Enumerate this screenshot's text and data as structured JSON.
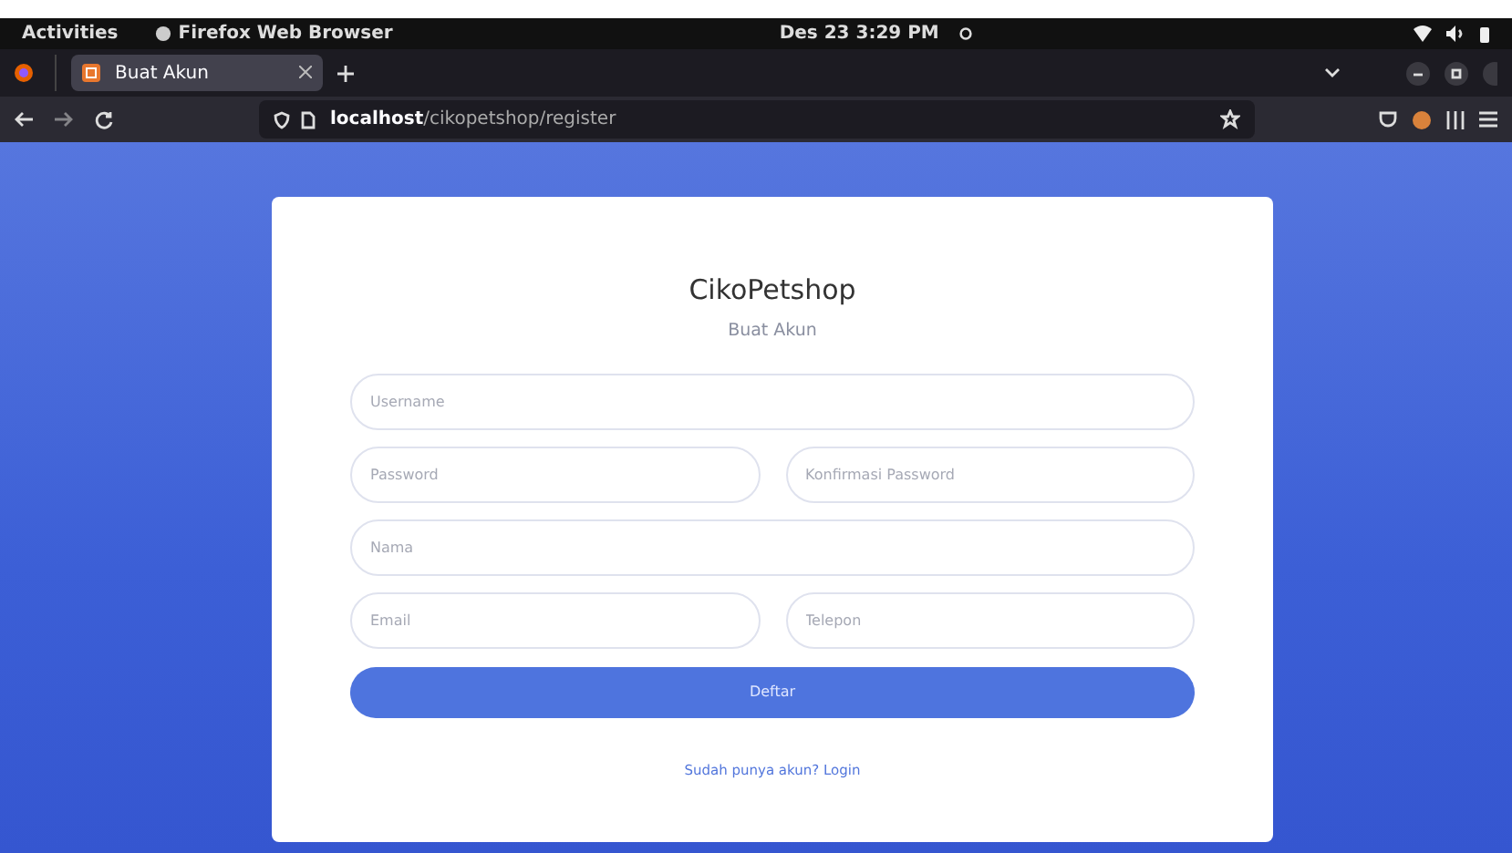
{
  "topbar": {
    "activities": "Activities",
    "app_name": "Firefox Web Browser",
    "clock": "Des 23  3:29 PM"
  },
  "tabs": [
    {
      "label": "Buat Akun",
      "selected": true
    }
  ],
  "address_bar": {
    "host": "localhost",
    "path": "/cikopetshop/register"
  },
  "form": {
    "title": "CikoPetshop",
    "subtitle": "Buat Akun",
    "rows": [
      [
        {
          "placeholder": "Username"
        }
      ],
      [
        {
          "placeholder": "Password"
        },
        {
          "placeholder": "Konfirmasi Password"
        }
      ],
      [
        {
          "placeholder": "Nama"
        }
      ],
      [
        {
          "placeholder": "Email"
        },
        {
          "placeholder": "Telepon"
        }
      ]
    ],
    "submit": "Deftar",
    "login_link": "Sudah punya akun? Login"
  }
}
